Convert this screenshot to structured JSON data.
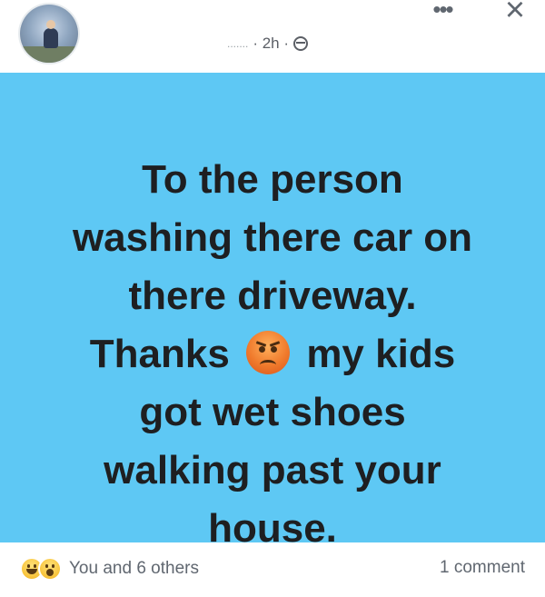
{
  "header": {
    "meta_dots": ".......",
    "time_ago": "· 2h ·",
    "privacy_icon": "globe-icon",
    "more_icon": "more-horizontal-icon",
    "close_icon": "close-icon"
  },
  "post": {
    "background_color": "#5ec8f4",
    "lines": [
      "To the person",
      "washing there car on",
      "there driveway."
    ],
    "line4_before": "Thanks",
    "line4_after": "my kids",
    "emoji": "angry-face-emoji",
    "lines_after": [
      "got wet shoes",
      "walking past your",
      "house."
    ]
  },
  "footer": {
    "reaction_icons": [
      "haha-icon",
      "wow-icon"
    ],
    "reactions_text": "You and 6 others",
    "comments_text": "1 comment"
  }
}
